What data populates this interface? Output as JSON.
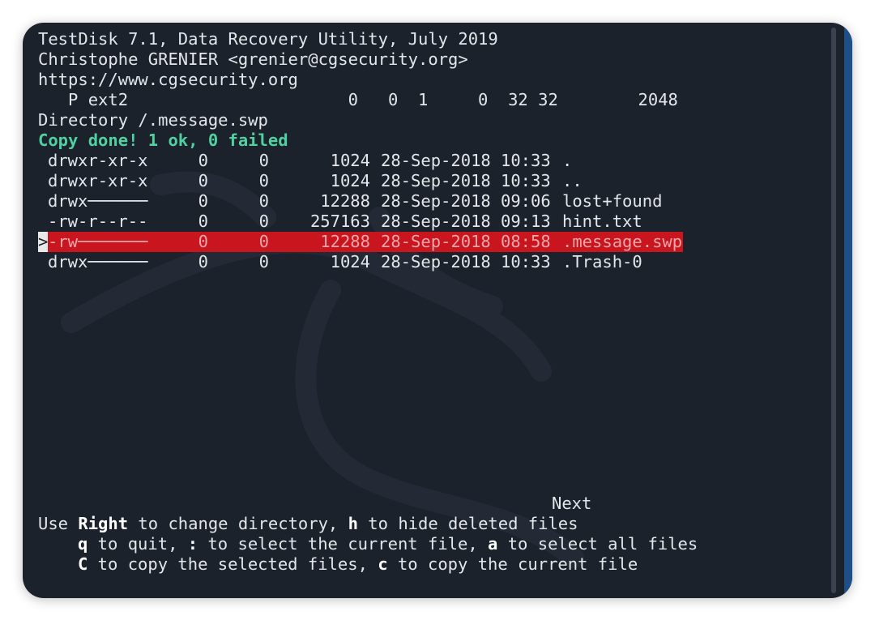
{
  "header": {
    "line1": "TestDisk 7.1, Data Recovery Utility, July 2019",
    "line2": "Christophe GRENIER <grenier@cgsecurity.org>",
    "line3": "https://www.cgsecurity.org",
    "partition": "   P ext2                      0   0  1     0  32 32        2048",
    "directory": "Directory /.message.swp",
    "status": "Copy done! 1 ok, 0 failed"
  },
  "files": [
    {
      "perm": "drwxr-xr-x",
      "uid": "0",
      "gid": "0",
      "size": "1024",
      "date": "28-Sep-2018",
      "time": "10:33",
      "name": "."
    },
    {
      "perm": "drwxr-xr-x",
      "uid": "0",
      "gid": "0",
      "size": "1024",
      "date": "28-Sep-2018",
      "time": "10:33",
      "name": ".."
    },
    {
      "perm": "drwx──────",
      "uid": "0",
      "gid": "0",
      "size": "12288",
      "date": "28-Sep-2018",
      "time": "09:06",
      "name": "lost+found"
    },
    {
      "perm": "-rw-r--r--",
      "uid": "0",
      "gid": "0",
      "size": "257163",
      "date": "28-Sep-2018",
      "time": "09:13",
      "name": "hint.txt"
    },
    {
      "perm": "-rw───────",
      "uid": "0",
      "gid": "0",
      "size": "12288",
      "date": "28-Sep-2018",
      "time": "08:58",
      "name": ".message.swp",
      "selected": true
    },
    {
      "perm": "drwx──────",
      "uid": "0",
      "gid": "0",
      "size": "1024",
      "date": "28-Sep-2018",
      "time": "10:33",
      "name": ".Trash-0"
    }
  ],
  "cursor": ">",
  "footer": {
    "next": "Next",
    "help1_pre": "Use ",
    "help1_key": "Right",
    "help1_mid": " to change directory, ",
    "help1_key2": "h",
    "help1_post": " to hide deleted files",
    "help2_key": "q",
    "help2_mid": " to quit, ",
    "help2_key2": ":",
    "help2_mid2": " to select the current file, ",
    "help2_key3": "a",
    "help2_post": " to select all files",
    "help3_key": "C",
    "help3_mid": " to copy the selected files, ",
    "help3_key2": "c",
    "help3_post": " to copy the current file"
  },
  "colors": {
    "background": "#1c222c",
    "selection": "#c8151e",
    "status_green": "#4fd1a0"
  }
}
